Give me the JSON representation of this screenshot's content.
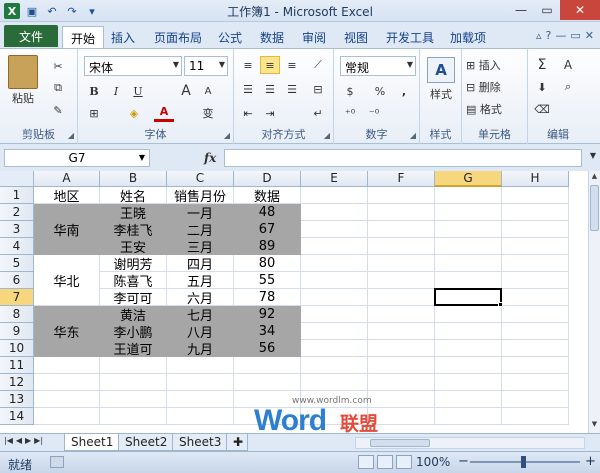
{
  "window": {
    "title": "工作簿1 - Microsoft Excel",
    "logo": "X",
    "close": "✕",
    "minimize": "—",
    "maximize": "▭"
  },
  "ribbon_tabs": [
    "文件",
    "开始",
    "插入",
    "页面布局",
    "公式",
    "数据",
    "审阅",
    "视图",
    "开发工具",
    "加载项"
  ],
  "ribbon": {
    "clipboard": {
      "label": "剪贴板",
      "paste": "粘贴"
    },
    "font": {
      "label": "字体",
      "name": "宋体",
      "size": "11",
      "bold": "B",
      "italic": "I",
      "underline": "U",
      "grow": "A",
      "shrink": "A",
      "color_glyph": "A",
      "phonetic": "变"
    },
    "alignment": {
      "label": "对齐方式"
    },
    "number": {
      "label": "数字",
      "format": "常规",
      "currency": "$",
      "percent": "%",
      "comma": ","
    },
    "styles": {
      "label": "样式",
      "button": "样式"
    },
    "cells": {
      "label": "单元格",
      "insert": "插入",
      "delete": "删除",
      "format": "格式"
    },
    "editing": {
      "label": "编辑",
      "sum": "Σ",
      "sort": "A"
    }
  },
  "formula_bar": {
    "name_box": "G7",
    "fx": "fx",
    "formula": ""
  },
  "columns": [
    "A",
    "B",
    "C",
    "D",
    "E",
    "F",
    "G",
    "H"
  ],
  "rows": [
    "1",
    "2",
    "3",
    "4",
    "5",
    "6",
    "7",
    "8",
    "9",
    "10",
    "11",
    "12",
    "13",
    "14"
  ],
  "headers": [
    "地区",
    "姓名",
    "销售月份",
    "数据"
  ],
  "regions": [
    "华南",
    "华北",
    "华东"
  ],
  "records": [
    [
      "王晓",
      "一月",
      "48"
    ],
    [
      "李桂飞",
      "二月",
      "67"
    ],
    [
      "王安",
      "三月",
      "89"
    ],
    [
      "谢明芳",
      "四月",
      "80"
    ],
    [
      "陈喜飞",
      "五月",
      "55"
    ],
    [
      "李可可",
      "六月",
      "78"
    ],
    [
      "黄洁",
      "七月",
      "92"
    ],
    [
      "李小鹏",
      "八月",
      "34"
    ],
    [
      "王道可",
      "九月",
      "56"
    ]
  ],
  "selected_cell": "G7",
  "sheets": [
    "Sheet1",
    "Sheet2",
    "Sheet3"
  ],
  "status": {
    "ready": "就绪",
    "zoom": "100%",
    "minus": "−",
    "plus": "+"
  },
  "watermark": {
    "url": "www.wordlm.com",
    "word": "Word",
    "cn": "联盟"
  },
  "colors": {
    "file_tab": "#2a6b3a",
    "gray_fill": "#a6a6a6",
    "selection_header": "#f7d77d"
  }
}
